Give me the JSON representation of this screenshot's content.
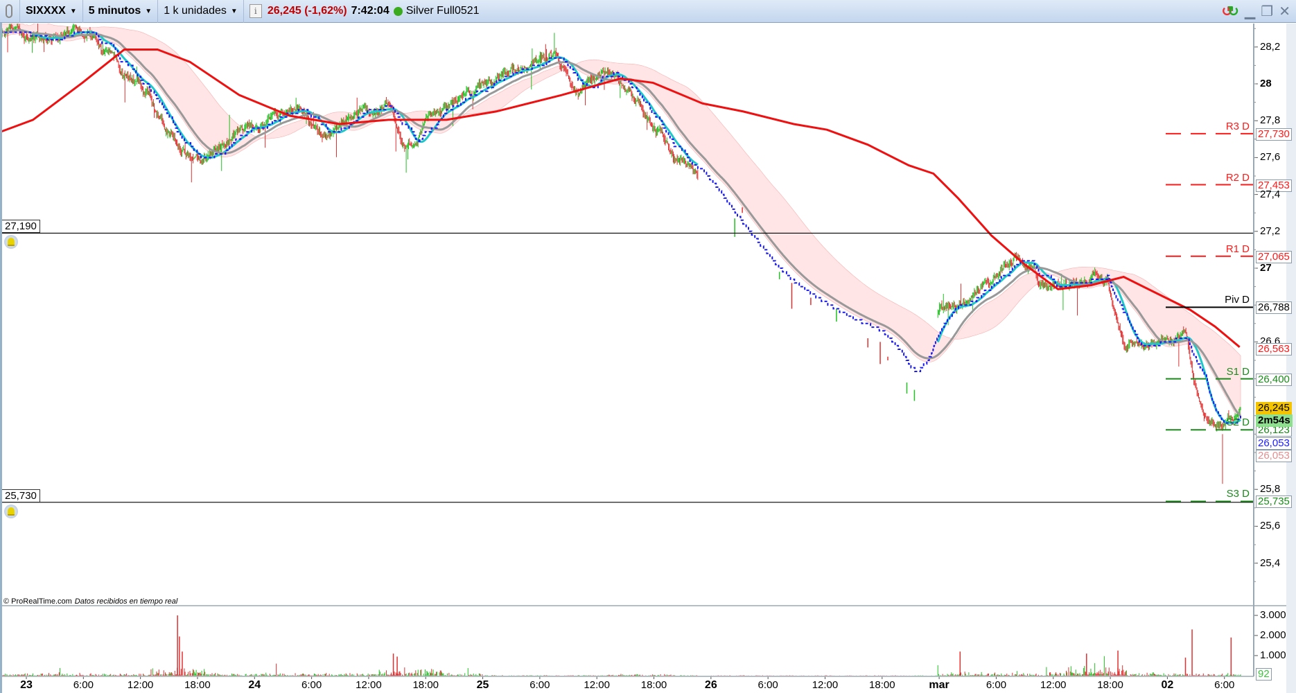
{
  "toolbar": {
    "symbol": "SIXXXX",
    "timeframe": "5 minutos",
    "units": "1 k unidades",
    "last_price": "26,245 (-1,62%)",
    "time": "7:42:04",
    "feed_status_color": "#3caa1e",
    "account": "Silver Full0521",
    "icons": [
      "link-icon",
      "info-icon",
      "refresh-icon",
      "minimize-icon",
      "restore-icon",
      "close-icon"
    ]
  },
  "footer_note": {
    "copyright": "© ProRealTime.com",
    "status": "Datos recibidos en tiempo real"
  },
  "price_axis": {
    "ticks": [
      {
        "value": 28.2,
        "label": "28,2",
        "bold": false
      },
      {
        "value": 28.0,
        "label": "28",
        "bold": true
      },
      {
        "value": 27.8,
        "label": "27,8",
        "bold": false
      },
      {
        "value": 27.6,
        "label": "27,6",
        "bold": false
      },
      {
        "value": 27.4,
        "label": "27,4",
        "bold": false
      },
      {
        "value": 27.2,
        "label": "27,2",
        "bold": false
      },
      {
        "value": 27.0,
        "label": "27",
        "bold": true
      },
      {
        "value": 26.6,
        "label": "26,6",
        "bold": false
      },
      {
        "value": 25.8,
        "label": "25,8",
        "bold": false
      },
      {
        "value": 25.6,
        "label": "25,6",
        "bold": false
      },
      {
        "value": 25.4,
        "label": "25,4",
        "bold": false
      }
    ]
  },
  "volume_axis": {
    "ticks": [
      {
        "value": 3000,
        "label": "3.000"
      },
      {
        "value": 2000,
        "label": "2.000"
      },
      {
        "value": 1000,
        "label": "1.000"
      }
    ],
    "current": {
      "value": 92,
      "label": "92",
      "color": "#3cc43c"
    }
  },
  "time_axis": [
    {
      "t": 0,
      "label": "23",
      "day": true
    },
    {
      "t": 6,
      "label": "6:00"
    },
    {
      "t": 12,
      "label": "12:00"
    },
    {
      "t": 18,
      "label": "18:00"
    },
    {
      "t": 24,
      "label": "24",
      "day": true
    },
    {
      "t": 30,
      "label": "6:00"
    },
    {
      "t": 36,
      "label": "12:00"
    },
    {
      "t": 42,
      "label": "18:00"
    },
    {
      "t": 48,
      "label": "25",
      "day": true
    },
    {
      "t": 54,
      "label": "6:00"
    },
    {
      "t": 60,
      "label": "12:00"
    },
    {
      "t": 66,
      "label": "18:00"
    },
    {
      "t": 72,
      "label": "26",
      "day": true
    },
    {
      "t": 78,
      "label": "6:00"
    },
    {
      "t": 84,
      "label": "12:00"
    },
    {
      "t": 90,
      "label": "18:00"
    },
    {
      "t": 96,
      "label": "mar",
      "day": true
    },
    {
      "t": 102,
      "label": "6:00"
    },
    {
      "t": 108,
      "label": "12:00"
    },
    {
      "t": 114,
      "label": "18:00"
    },
    {
      "t": 120,
      "label": "02",
      "day": true
    },
    {
      "t": 126,
      "label": "6:00"
    }
  ],
  "alerts": [
    {
      "value": 27.19,
      "label": "27,190"
    },
    {
      "value": 25.73,
      "label": "25,730"
    }
  ],
  "pivots": [
    {
      "name": "R3 D",
      "value": 27.73,
      "label": "27,730",
      "color": "#ff1a1a",
      "solid": false
    },
    {
      "name": "R2 D",
      "value": 27.453,
      "label": "27,453",
      "color": "#ff1a1a",
      "solid": false
    },
    {
      "name": "R1 D",
      "value": 27.065,
      "label": "27,065",
      "color": "#ff1a1a",
      "solid": false
    },
    {
      "name": "Piv D",
      "value": 26.788,
      "label": "26,788",
      "color": "#000000",
      "solid": true
    },
    {
      "name": "S1 D",
      "value": 26.4,
      "label": "26,400",
      "color": "#1a8a1a",
      "solid": false
    },
    {
      "name": "S2 D",
      "value": 26.123,
      "label": "26,123",
      "color": "#1a8a1a",
      "solid": false
    },
    {
      "name": "S3 D",
      "value": 25.735,
      "label": "25,735",
      "color": "#1a8a1a",
      "solid": false
    }
  ],
  "value_tags": [
    {
      "value": 26.563,
      "label": "26,563",
      "color": "#ff1a1a",
      "bg": "#ffffff"
    },
    {
      "value": 26.053,
      "label": "26,053",
      "color": "#1a1aff",
      "bg": "#ffffff"
    },
    {
      "value": 26.053,
      "label": "26,053",
      "color": "#e09090",
      "bg": "#ffffff",
      "offset": 1
    },
    {
      "value": 26.245,
      "label": "26,245",
      "color": "#000000",
      "bg": "#f5c400"
    },
    {
      "value": 26.245,
      "label": "2m54s",
      "color": "#000000",
      "bg": "#8ee08e",
      "offset": 1,
      "bold": true
    }
  ],
  "chart_data": {
    "type": "candlestick",
    "interval": "5 minutos",
    "colors": {
      "up": "#22c022",
      "down": "#e03030",
      "ma_long": "#ee1111",
      "ma_gray": "#999999",
      "ma_cyan": "#22c8c8",
      "dashed": "#1a1aee",
      "cloud_pink": "#ffd0d0",
      "cloud_cyan": "#d0f4f8"
    },
    "close_path": [
      [
        -2.8,
        28.27
      ],
      [
        1.6,
        28.25
      ],
      [
        6.8,
        28.27
      ],
      [
        10.3,
        28.05
      ],
      [
        12.4,
        27.96
      ],
      [
        15.9,
        27.69
      ],
      [
        17.7,
        27.58
      ],
      [
        19.8,
        27.62
      ],
      [
        23.3,
        27.76
      ],
      [
        26.8,
        27.82
      ],
      [
        28.5,
        27.9
      ],
      [
        31.1,
        27.71
      ],
      [
        33.7,
        27.8
      ],
      [
        38.1,
        27.87
      ],
      [
        39.8,
        27.62
      ],
      [
        42.4,
        27.82
      ],
      [
        45.9,
        27.92
      ],
      [
        49.4,
        28.03
      ],
      [
        52.8,
        28.1
      ],
      [
        55.5,
        28.16
      ],
      [
        58.1,
        27.94
      ],
      [
        60.7,
        28.07
      ],
      [
        63.3,
        27.97
      ],
      [
        65.9,
        27.78
      ],
      [
        68.5,
        27.58
      ],
      [
        70.7,
        27.51
      ],
      [
        74,
        27.27
      ],
      [
        79,
        26.95
      ],
      [
        85,
        26.75
      ],
      [
        90,
        26.64
      ],
      [
        93,
        26.38
      ],
      [
        95.8,
        26.75
      ],
      [
        98,
        26.83
      ],
      [
        101.5,
        26.93
      ],
      [
        104.2,
        27.09
      ],
      [
        106.8,
        26.91
      ],
      [
        110.2,
        26.91
      ],
      [
        112,
        26.97
      ],
      [
        113.7,
        26.93
      ],
      [
        115.4,
        26.62
      ],
      [
        117.2,
        26.59
      ],
      [
        120.6,
        26.59
      ],
      [
        122,
        26.66
      ],
      [
        122.8,
        26.35
      ],
      [
        124.1,
        26.15
      ],
      [
        125.9,
        26.13
      ],
      [
        127.7,
        26.24
      ]
    ],
    "sparse_ticks": [
      [
        74.5,
        27.27,
        27.17
      ],
      [
        75.3,
        27.33,
        27.3
      ],
      [
        79.2,
        26.98,
        26.94
      ],
      [
        80.5,
        26.92,
        26.78
      ],
      [
        82.5,
        26.84,
        26.8
      ],
      [
        85.2,
        26.78,
        26.71
      ],
      [
        88.5,
        26.62,
        26.57
      ],
      [
        89.8,
        26.6,
        26.48
      ],
      [
        90.6,
        26.52,
        26.5
      ],
      [
        92.6,
        26.38,
        26.32
      ],
      [
        93.4,
        26.34,
        26.28
      ]
    ],
    "ma_long": [
      [
        -2.8,
        27.738
      ],
      [
        0.7,
        27.805
      ],
      [
        5.9,
        28.006
      ],
      [
        10.3,
        28.186
      ],
      [
        13.8,
        28.186
      ],
      [
        17.2,
        28.119
      ],
      [
        22.4,
        27.939
      ],
      [
        27.7,
        27.827
      ],
      [
        32.9,
        27.782
      ],
      [
        38.1,
        27.805
      ],
      [
        44.2,
        27.805
      ],
      [
        49.4,
        27.85
      ],
      [
        56.3,
        27.939
      ],
      [
        62.5,
        28.029
      ],
      [
        65.9,
        28.006
      ],
      [
        71.1,
        27.894
      ],
      [
        75.4,
        27.85
      ],
      [
        80.7,
        27.782
      ],
      [
        84.2,
        27.751
      ],
      [
        88.5,
        27.67
      ],
      [
        92.8,
        27.558
      ],
      [
        95.4,
        27.513
      ],
      [
        98,
        27.379
      ],
      [
        101.5,
        27.177
      ],
      [
        105,
        27.02
      ],
      [
        108.5,
        26.886
      ],
      [
        112,
        26.908
      ],
      [
        115.4,
        26.953
      ],
      [
        118.9,
        26.863
      ],
      [
        122.4,
        26.774
      ],
      [
        125,
        26.684
      ],
      [
        127.6,
        26.572
      ]
    ],
    "volume_spikes": [
      [
        15.9,
        3000
      ],
      [
        16.1,
        1950
      ],
      [
        16.4,
        1200
      ],
      [
        38.6,
        1100
      ],
      [
        39.0,
        950
      ],
      [
        98.2,
        1200
      ],
      [
        111.5,
        1100
      ],
      [
        114.8,
        1250
      ],
      [
        122.6,
        2300
      ],
      [
        121.9,
        900
      ],
      [
        126.7,
        1900
      ]
    ]
  }
}
